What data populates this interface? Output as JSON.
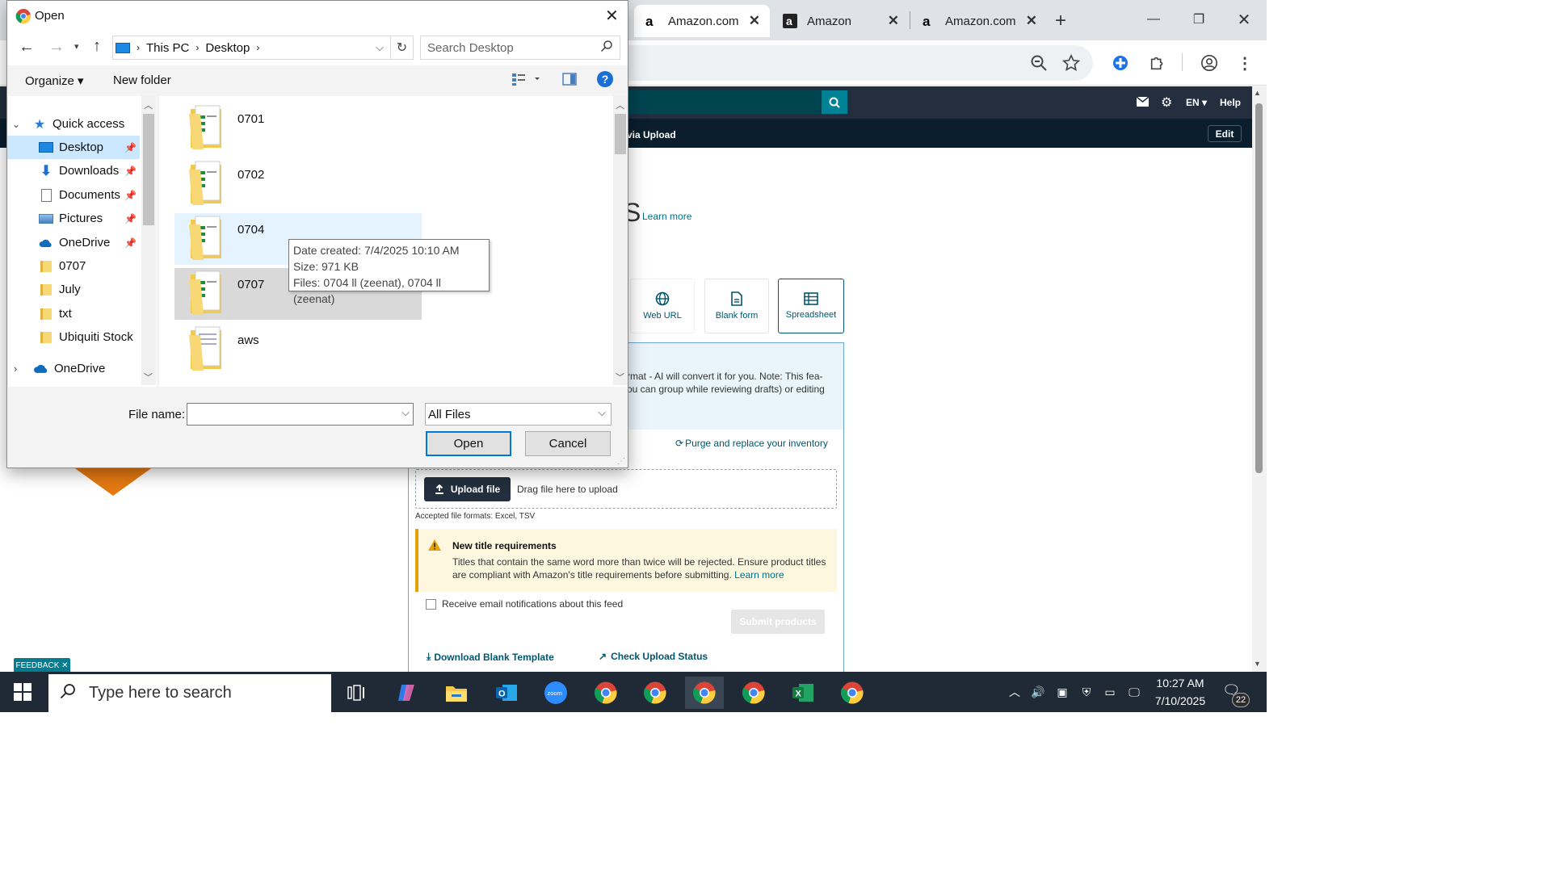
{
  "browser": {
    "tabs": [
      {
        "title": "Amazon.com",
        "active": true
      },
      {
        "title": "Amazon",
        "active": false
      },
      {
        "title": "Amazon.com",
        "active": false
      }
    ],
    "new_tab": "+",
    "window_controls": {
      "minimize": "—",
      "restore": "❐",
      "close": "✕"
    }
  },
  "amazon": {
    "nav_lang": "EN ▾",
    "nav_help": "Help",
    "sub_title": "via Upload",
    "edit": "Edit",
    "heading_tail": "S",
    "learn_more": "Learn more",
    "options": [
      "Web URL",
      "Blank form",
      "Spreadsheet"
    ],
    "notice_line1": "rmat - AI will convert it for you. Note: This fea-",
    "notice_line2": "ou can group while reviewing drafts) or editing",
    "purge": "Purge and replace your inventory",
    "upload_file": "Upload file",
    "drag_text": "Drag file here to upload",
    "accepted": "Accepted file formats: Excel, TSV",
    "warn_title": "New title requirements",
    "warn_line1": "Titles that contain the same word more than twice will be rejected. Ensure product titles",
    "warn_line2": "are compliant with Amazon's title requirements before submitting.",
    "warn_learn": "Learn more",
    "email_notify": "Receive email notifications about this feed",
    "submit": "Submit products",
    "download_template": "Download Blank Template",
    "check_status": "Check Upload Status",
    "feedback": "FEEDBACK ✕"
  },
  "dialog": {
    "title": "Open",
    "breadcrumb": [
      "This PC",
      "Desktop"
    ],
    "search_placeholder": "Search Desktop",
    "organize": "Organize ▾",
    "new_folder": "New folder",
    "nav": [
      {
        "label": "Quick access",
        "pinned": false
      },
      {
        "label": "Desktop",
        "pinned": true
      },
      {
        "label": "Downloads",
        "pinned": true
      },
      {
        "label": "Documents",
        "pinned": true
      },
      {
        "label": "Pictures",
        "pinned": true
      },
      {
        "label": "OneDrive",
        "pinned": true
      },
      {
        "label": "0707",
        "pinned": false
      },
      {
        "label": "July",
        "pinned": false
      },
      {
        "label": "txt",
        "pinned": false
      },
      {
        "label": "Ubiquiti Stock",
        "pinned": false
      },
      {
        "label": "OneDrive",
        "pinned": false
      }
    ],
    "files": [
      "0701",
      "0702",
      "0704",
      "0707",
      "aws"
    ],
    "tooltip": {
      "created": "Date created: 7/4/2025 10:10 AM",
      "size": "Size: 971 KB",
      "files": "Files: 0704 ll (zeenat), 0704 ll (zeenat)"
    },
    "file_name_label": "File name:",
    "file_name_value": "",
    "file_type": "All Files",
    "open": "Open",
    "cancel": "Cancel"
  },
  "taskbar": {
    "search_placeholder": "Type here to search",
    "time": "10:27 AM",
    "date": "7/10/2025",
    "notifications": "22"
  }
}
